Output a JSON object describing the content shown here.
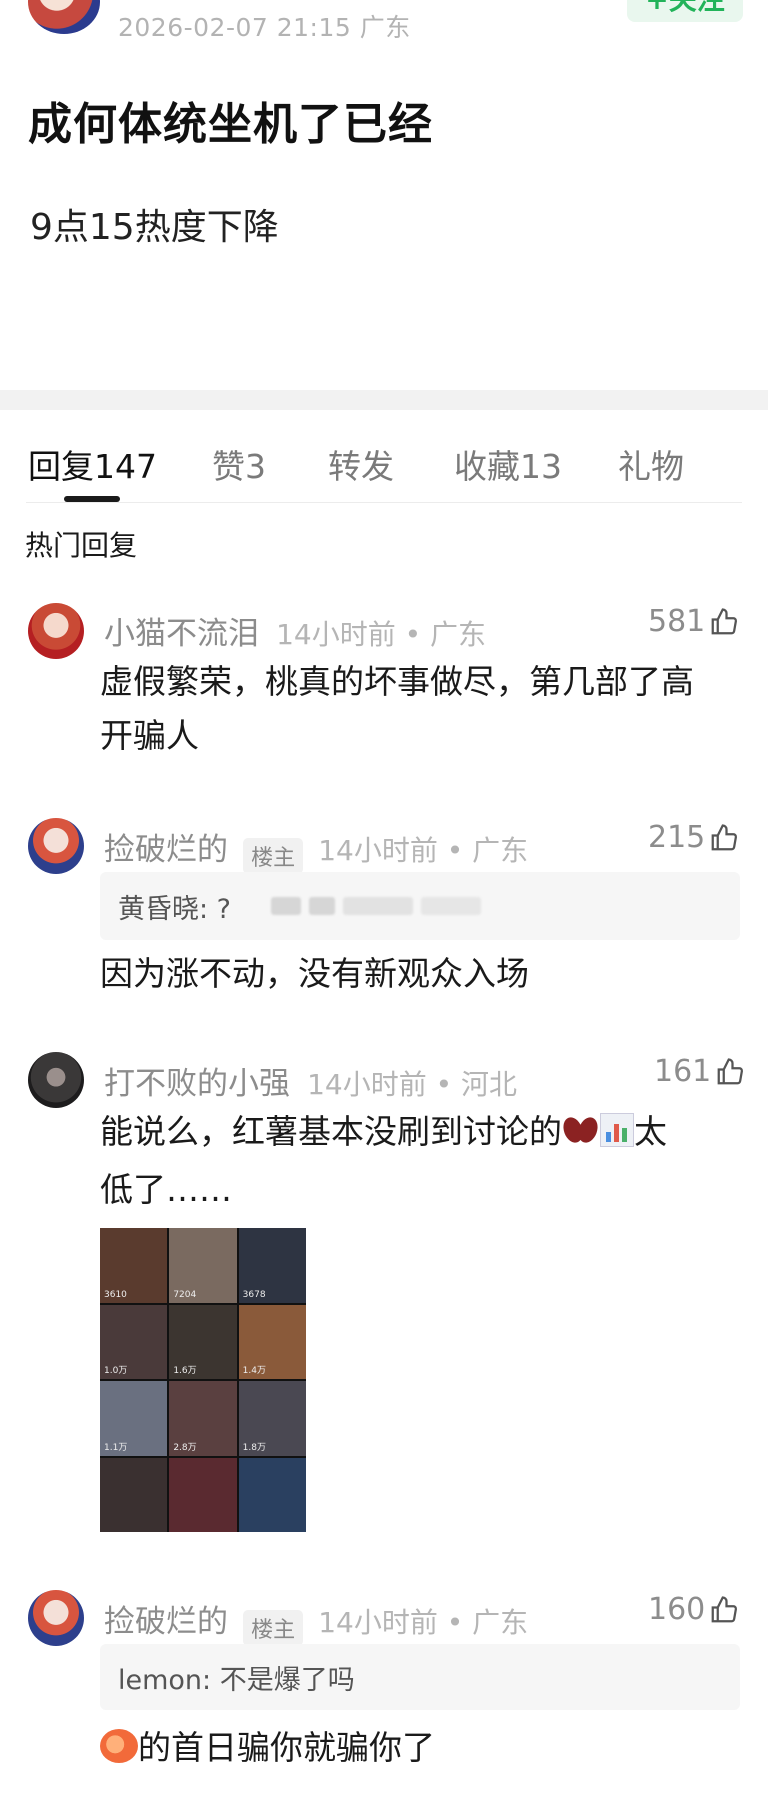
{
  "post": {
    "meta": "2026-02-07 21:15  广东",
    "follow_label": "+关注",
    "title": "成何体统坐机了已经",
    "body": "9点15热度下降"
  },
  "tabs": [
    {
      "label": "回复147",
      "active": true
    },
    {
      "label": "赞3",
      "active": false
    },
    {
      "label": "转发",
      "active": false
    },
    {
      "label": "收藏13",
      "active": false
    },
    {
      "label": "礼物",
      "active": false
    }
  ],
  "hot_label": "热门回复",
  "comments": [
    {
      "name": "小猫不流泪",
      "time": "14小时前 • 广东",
      "likes": "581",
      "text1": "虚假繁荣，桃真的坏事做尽，第几部了高",
      "text2": "开骗人"
    },
    {
      "name": "捡破烂的",
      "badge": "楼主",
      "time": "14小时前 • 广东",
      "likes": "215",
      "quote": "黄昏晓: ?",
      "text1": "因为涨不动，没有新观众入场"
    },
    {
      "name": "打不败的小强",
      "time": "14小时前 • 河北",
      "likes": "161",
      "text1": "能说么，红薯基本没刷到讨论的",
      "text1_tail": "太",
      "text2": "低了……",
      "image_captions": [
        "3610",
        "7204",
        "3678",
        "1.0万",
        "1.6万",
        "1.4万",
        "1.1万",
        "2.8万",
        "1.8万"
      ]
    },
    {
      "name": "捡破烂的",
      "badge": "楼主",
      "time": "14小时前 • 广东",
      "likes": "160",
      "quote": "lemon: 不是爆了吗",
      "text1": "的首日骗你就骗你了"
    }
  ],
  "colors": {
    "accent_green": "#22b35a",
    "muted": "#8c8c8c"
  }
}
